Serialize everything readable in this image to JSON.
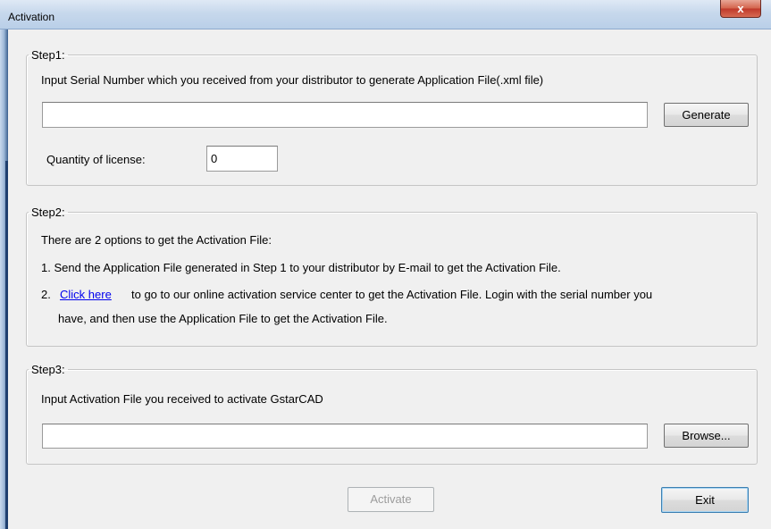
{
  "window": {
    "title": "Activation",
    "close_glyph": "x"
  },
  "step1": {
    "legend": "Step1:",
    "instruction": "Input Serial Number which you received from your distributor to generate Application File(.xml file)",
    "serial_value": "",
    "generate_label": "Generate",
    "quantity_label": "Quantity of license:",
    "quantity_value": "0"
  },
  "step2": {
    "legend": "Step2:",
    "intro": "There are 2 options to get the Activation File:",
    "option1": "1.  Send the Application File generated in Step 1 to your distributor by E-mail to get the Activation File.",
    "option2_prefix": "2.",
    "option2_link": "Click here",
    "option2_line1": "to go to our online activation service center to get the Activation File. Login with the serial number you",
    "option2_line2": "have, and then use the Application File to get the Activation File."
  },
  "step3": {
    "legend": "Step3:",
    "instruction": "Input Activation File you received to activate GstarCAD",
    "file_value": "",
    "browse_label": "Browse..."
  },
  "footer": {
    "activate_label": "Activate",
    "exit_label": "Exit"
  },
  "colors": {
    "link": "#0000ee",
    "close_button": "#c0392b",
    "titlebar": "#c7d8ec"
  }
}
